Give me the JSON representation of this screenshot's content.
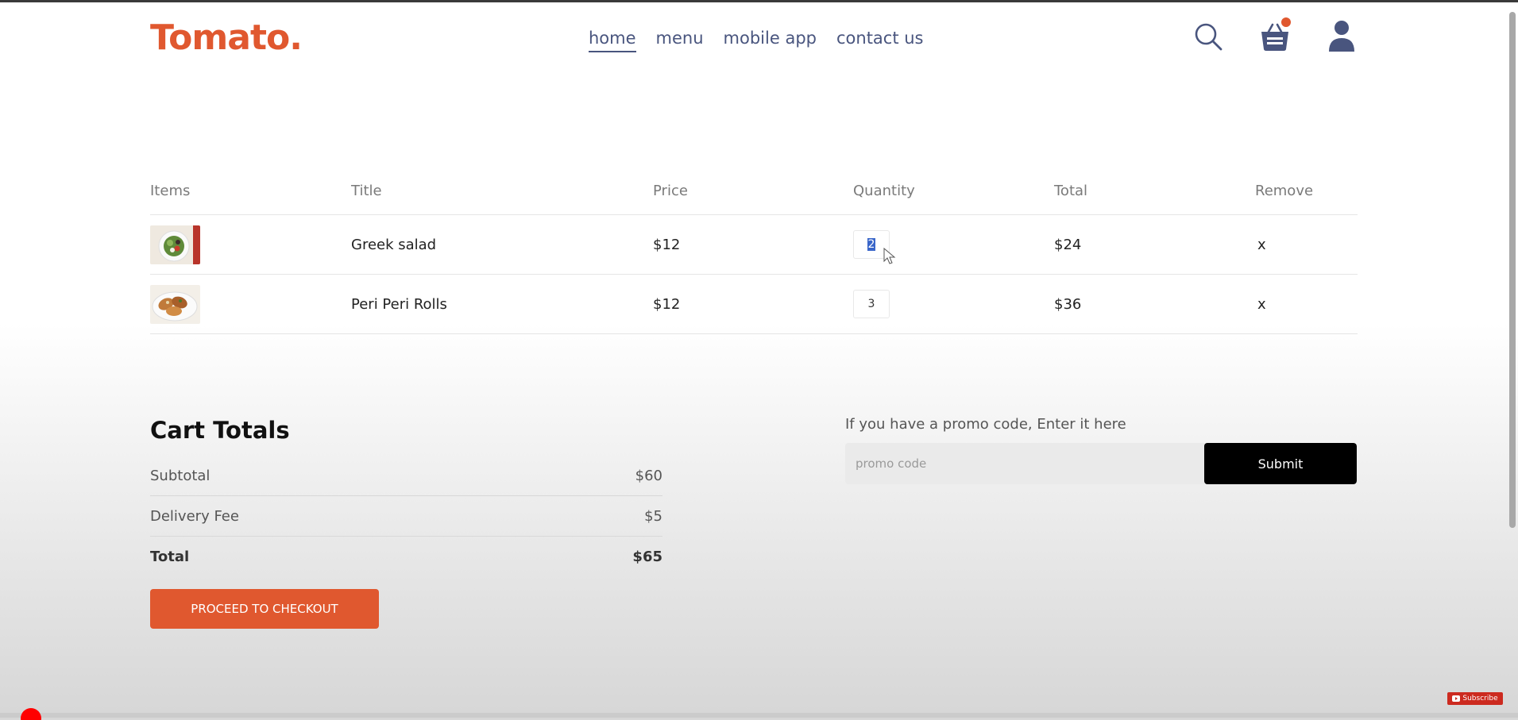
{
  "brand": {
    "logo": "Tomato.",
    "accent_color": "#e0582f",
    "nav_color": "#49557e"
  },
  "nav": {
    "items": [
      {
        "label": "home",
        "active": true
      },
      {
        "label": "menu",
        "active": false
      },
      {
        "label": "mobile app",
        "active": false
      },
      {
        "label": "contact us",
        "active": false
      }
    ],
    "icons": [
      "search-icon",
      "basket-icon",
      "profile-icon"
    ]
  },
  "cart": {
    "headers": [
      "Items",
      "Title",
      "Price",
      "Quantity",
      "Total",
      "Remove"
    ],
    "rows": [
      {
        "image": "greek-salad-thumbnail",
        "title": "Greek salad",
        "price": "$12",
        "quantity": "2",
        "total": "$24",
        "remove": "x"
      },
      {
        "image": "peri-peri-rolls-thumbnail",
        "title": "Peri Peri Rolls",
        "price": "$12",
        "quantity": "3",
        "total": "$36",
        "remove": "x"
      }
    ]
  },
  "totals": {
    "heading": "Cart Totals",
    "subtotal_label": "Subtotal",
    "subtotal_value": "$60",
    "delivery_label": "Delivery Fee",
    "delivery_value": "$5",
    "total_label": "Total",
    "total_value": "$65",
    "checkout_label": "PROCEED TO CHECKOUT"
  },
  "promo": {
    "prompt": "If you have a promo code, Enter it here",
    "placeholder": "promo code",
    "submit_label": "Submit"
  },
  "overlay": {
    "subscribe_label": "Subscribe"
  }
}
